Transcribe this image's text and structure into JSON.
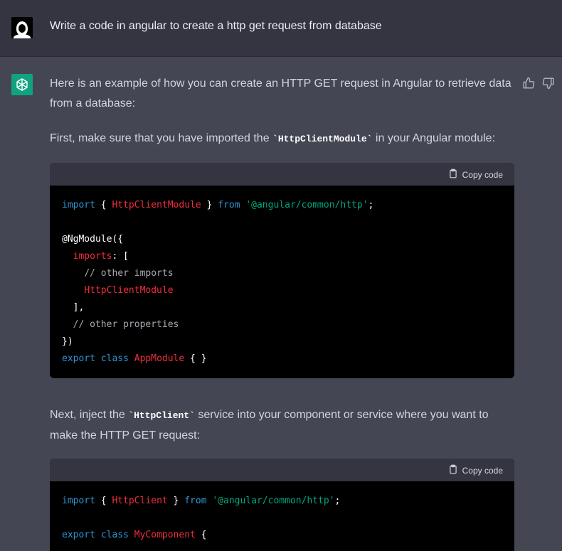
{
  "user_message": "Write a code in angular to create a http get request from database",
  "assistant": {
    "intro": "Here is an example of how you can create an HTTP GET request in Angular to retrieve data from a database:",
    "step1_pre": "First, make sure that you have imported the ",
    "step1_code": "`HttpClientModule`",
    "step1_post": " in your Angular module:",
    "copy_label": "Copy code",
    "code1": {
      "l1_import": "import",
      "l1_open": " { ",
      "l1_id": "HttpClientModule",
      "l1_close": " } ",
      "l1_from": "from",
      "l1_str": "'@angular/common/http'",
      "l1_semi": ";",
      "l3": "@NgModule({",
      "l4_key": "imports",
      "l4_rest": ": [",
      "l5": "// other imports",
      "l6": "HttpClientModule",
      "l7": "],",
      "l8": "// other properties",
      "l9": "})",
      "l10_export": "export",
      "l10_class": "class",
      "l10_name": "AppModule",
      "l10_rest": " { }"
    },
    "step2_pre": "Next, inject the ",
    "step2_code": "`HttpClient`",
    "step2_post": " service into your component or service where you want to make the HTTP GET request:",
    "code2": {
      "l1_import": "import",
      "l1_open": " { ",
      "l1_id": "HttpClient",
      "l1_close": " } ",
      "l1_from": "from",
      "l1_str": "'@angular/common/http'",
      "l1_semi": ";",
      "l3_export": "export",
      "l3_class": "class",
      "l3_name": "MyComponent",
      "l3_rest": " {"
    }
  },
  "icons": [
    "user-avatar",
    "openai-logo",
    "thumbs-up-icon",
    "thumbs-down-icon",
    "clipboard-icon"
  ],
  "colors": {
    "user_bg": "#343541",
    "bot_bg": "#444654",
    "brand": "#10a37f",
    "keyword": "#2e95d3",
    "identifier": "#f22c3d",
    "string": "#00a67d",
    "comment": "#a9a9b3"
  }
}
